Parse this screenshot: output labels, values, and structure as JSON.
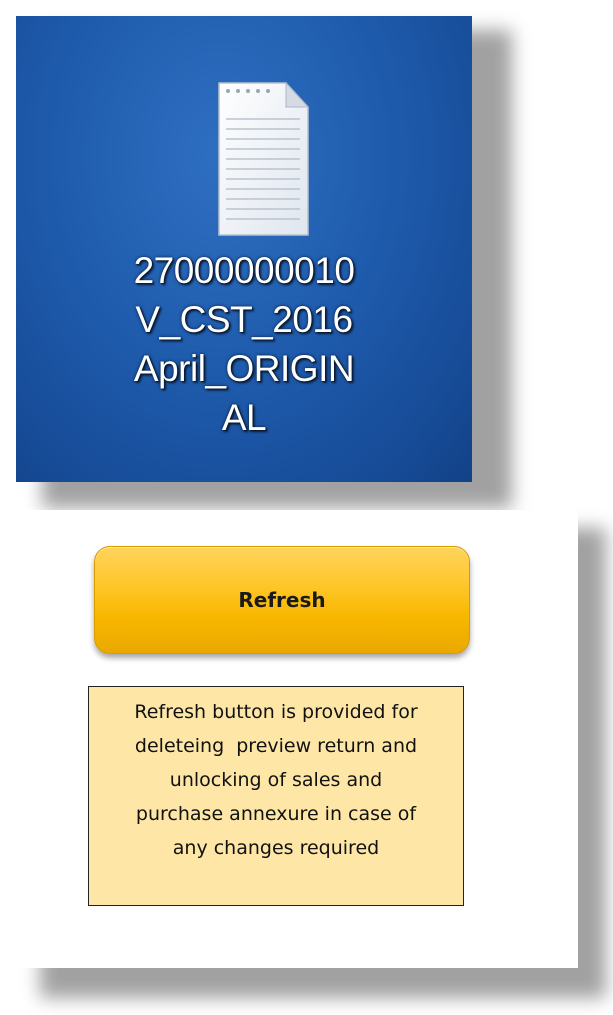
{
  "desktop": {
    "background_color": "#1f5cae",
    "file_icon": "text-document-icon",
    "file_label_lines": [
      "27000000010",
      "V_CST_2016",
      "April_ORIGIN",
      "AL"
    ]
  },
  "panel": {
    "refresh_button_label": "Refresh",
    "button_color": "#f8b800",
    "note_lines": [
      "Refresh button is provided for",
      "deleteing  preview return and",
      "unlocking of sales and",
      "purchase annexure in case of",
      "any changes required"
    ],
    "note_color": "#fde6a6"
  }
}
